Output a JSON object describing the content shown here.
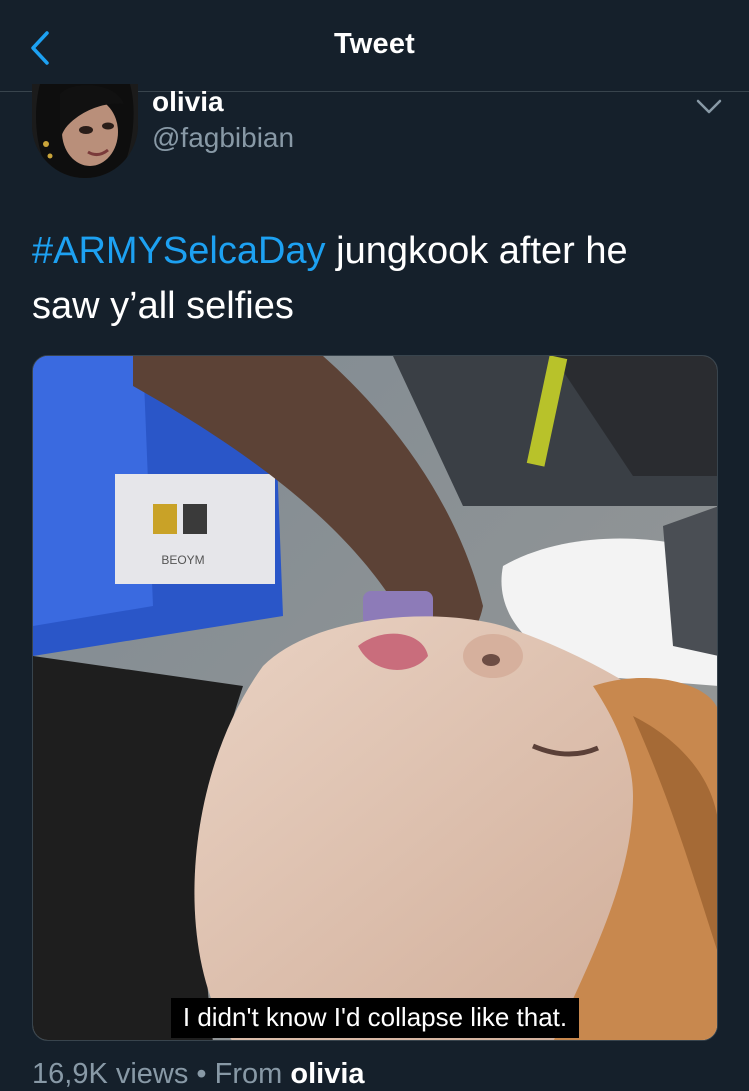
{
  "nav": {
    "title": "Tweet",
    "back_icon": "chevron-left-icon",
    "accent_color": "#1da1f2"
  },
  "tweet": {
    "author": {
      "name": "olivia",
      "handle": "@fagbibian"
    },
    "text": {
      "hashtag": "#ARMYSelcaDay",
      "line1_rest": " jungkook after he",
      "line2": "saw y’all selfies"
    },
    "media": {
      "subtitle": "I didn't know I'd collapse like that.",
      "box_label": "BEOYM"
    },
    "meta": {
      "views": "16,9K views",
      "separator": "•",
      "from_prefix": "From",
      "source": "olivia"
    }
  },
  "colors": {
    "background": "#15202b",
    "text": "#ffffff",
    "secondary": "#8899a6",
    "divider": "#38444d",
    "link": "#1da1f2"
  }
}
